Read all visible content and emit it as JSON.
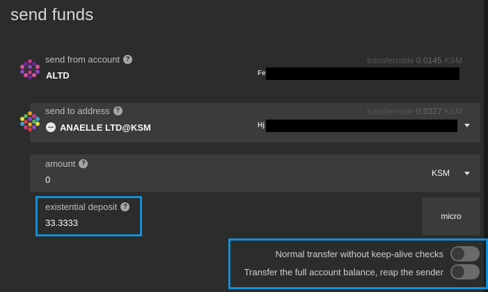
{
  "page": {
    "title": "send funds"
  },
  "from": {
    "label": "send from account",
    "account_name": "ALTD",
    "balance_label": "transferrable",
    "balance_value": "0.0145",
    "balance_unit": "KSM",
    "address_prefix": "Fe"
  },
  "to": {
    "label": "send to address",
    "account_name": "ANAELLE LTD@KSM",
    "balance_label": "transferrable",
    "balance_value": "0.0327",
    "balance_unit": "KSM",
    "address_prefix": "Hj"
  },
  "amount": {
    "label": "amount",
    "value": "0",
    "unit": "KSM"
  },
  "deposit": {
    "label": "existential deposit",
    "value": "33.3333",
    "unit": "micro"
  },
  "options": {
    "keep_alive_label": "Normal transfer without keep-alive checks",
    "reap_label": "Transfer the full account balance, reap the sender"
  },
  "colors": {
    "accent": "#1090d8",
    "background": "#2c2c2c",
    "panel": "#3b3b3b"
  }
}
